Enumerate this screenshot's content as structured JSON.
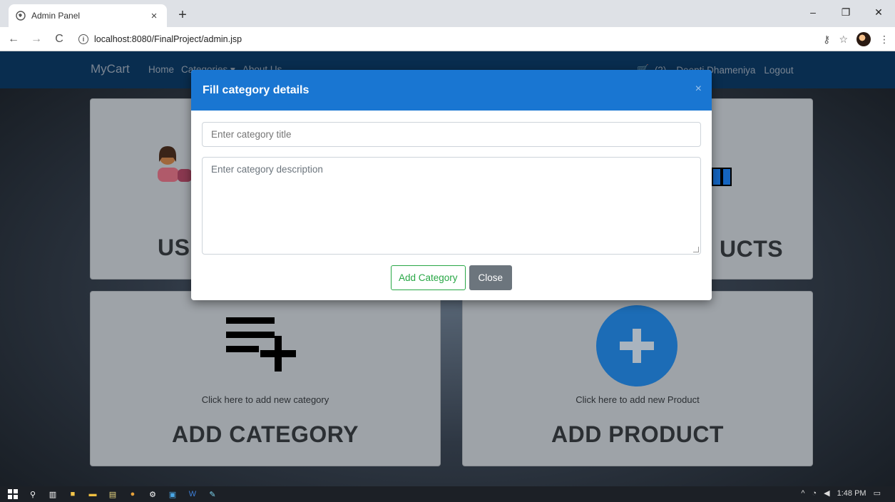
{
  "browser": {
    "tab_title": "Admin Panel",
    "tab_close": "×",
    "new_tab": "+",
    "url": "localhost:8080/FinalProject/admin.jsp",
    "window_controls": [
      "–",
      "❐",
      "✕"
    ]
  },
  "navbar": {
    "brand": "MyCart",
    "links": [
      "Home",
      "Categories ▾",
      "About Us"
    ],
    "cart": "(2)",
    "user": "Deepti Dhameniya",
    "logout": "Logout"
  },
  "cards": {
    "users_partial": "US",
    "products_partial": "UCTS",
    "add_category": {
      "subtitle": "Click here to add new category",
      "title": "ADD CATEGORY"
    },
    "add_product": {
      "subtitle": "Click here to add new Product",
      "title": "ADD PRODUCT"
    }
  },
  "modal": {
    "title": "Fill category details",
    "close_glyph": "×",
    "title_placeholder": "Enter category title",
    "description_placeholder": "Enter category description",
    "add_button": "Add Category",
    "close_button": "Close"
  },
  "taskbar": {
    "time": "1:48 PM"
  },
  "colors": {
    "modal_header": "#1976d2",
    "navbar": "#0d3e6e",
    "add_button": "#28a745",
    "close_button": "#6c757d",
    "product_circle": "#1c7ed6"
  }
}
